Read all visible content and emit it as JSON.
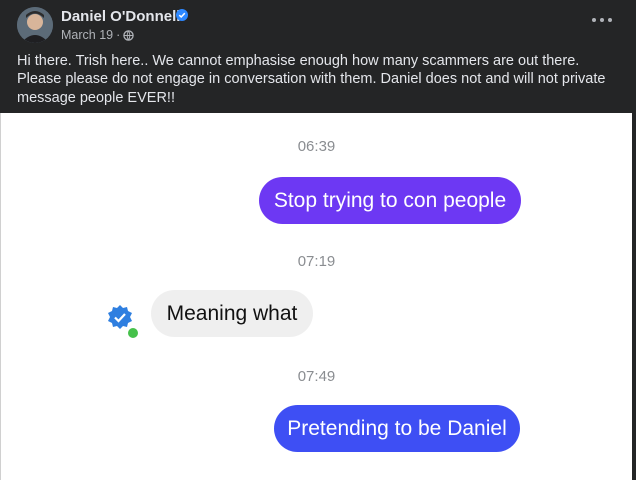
{
  "post": {
    "author": "Daniel O'Donnell",
    "date": "March 19",
    "separator": "·",
    "text": "Hi there. Trish here.. We cannot emphasise enough how many scammers are out there. Please please do not engage in conversation with them. Daniel does not and will not private message people EVER!!",
    "verified_color": "#2d88ff"
  },
  "chat": {
    "messages": [
      {
        "time": "06:39",
        "text": "Stop trying to con people",
        "sender": "self",
        "color": "#6d38f3"
      },
      {
        "time": "07:19",
        "text": "Meaning what",
        "sender": "other",
        "color": "#efefef"
      },
      {
        "time": "07:49",
        "text": "Pretending to be Daniel",
        "sender": "self",
        "color": "#3e4ff4"
      }
    ]
  },
  "icons": {
    "verified": "verified-badge-icon",
    "audience": "globe-icon",
    "more": "more-options-icon",
    "contact_online": "online-status-icon"
  }
}
